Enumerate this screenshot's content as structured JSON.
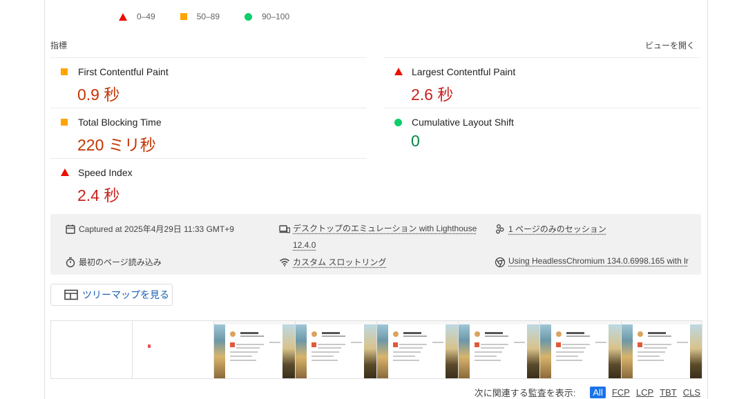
{
  "legend": [
    {
      "shape": "triangle",
      "label": "0–49"
    },
    {
      "shape": "square",
      "label": "50–89"
    },
    {
      "shape": "circle",
      "label": "90–100"
    }
  ],
  "metrics_section": {
    "title": "指標",
    "toggle_label": "ビューを開く"
  },
  "metrics": [
    {
      "name": "First Contentful Paint",
      "value": "0.9 秒",
      "rating": "average"
    },
    {
      "name": "Largest Contentful Paint",
      "value": "2.6 秒",
      "rating": "fail"
    },
    {
      "name": "Total Blocking Time",
      "value": "220 ミリ秒",
      "rating": "average"
    },
    {
      "name": "Cumulative Layout Shift",
      "value": "0",
      "rating": "pass"
    },
    {
      "name": "Speed Index",
      "value": "2.4 秒",
      "rating": "fail"
    }
  ],
  "run_info": {
    "captured": "Captured at 2025年4月29日 11:33 GMT+9",
    "emulation_line1": "デスクトップのエミュレーション with Lighthouse",
    "emulation_line2": "12.4.0",
    "session": "1 ページのみのセッション",
    "load": "最初のページ読み込み",
    "throttling": "カスタム スロットリング",
    "browser": "Using HeadlessChromium 134.0.6998.165 with lr"
  },
  "treemap_button": "ツリーマップを見る",
  "filter": {
    "label": "次に関連する監査を表示:",
    "chips": [
      "All",
      "FCP",
      "LCP",
      "TBT",
      "CLS"
    ],
    "active": "All"
  },
  "colors": {
    "fail": "#eb0f00",
    "average": "#ffa400",
    "pass": "#0cce6b",
    "link": "#1a73e8"
  },
  "icons": [
    "calendar-icon",
    "devices-icon",
    "users-icon",
    "stopwatch-icon",
    "wifi-icon",
    "chrome-icon",
    "treemap-icon"
  ]
}
